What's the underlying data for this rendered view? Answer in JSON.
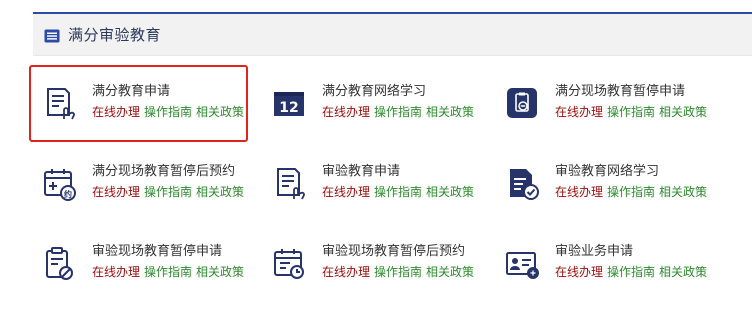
{
  "panel": {
    "title": "满分审验教育",
    "header_icon": "list-card-icon"
  },
  "links": {
    "online": "在线办理",
    "guide": "操作指南",
    "policy": "相关政策"
  },
  "colors": {
    "accent": "#2c4aa7",
    "icon_dark": "#27346a",
    "online": "#9b0d0d",
    "green": "#2e8b2e",
    "highlight": "#e0241b"
  },
  "items": [
    {
      "name": "满分教育申请",
      "icon": "form-hand-icon",
      "selected": true
    },
    {
      "name": "满分教育网络学习",
      "icon": "calendar-12-icon"
    },
    {
      "name": "满分现场教育暂停申请",
      "icon": "clipboard-minus-icon"
    },
    {
      "name": "满分现场教育暂停后预约",
      "icon": "calendar-appointment-icon"
    },
    {
      "name": "审验教育申请",
      "icon": "form-hand-icon"
    },
    {
      "name": "审验教育网络学习",
      "icon": "document-check-icon"
    },
    {
      "name": "审验现场教育暂停申请",
      "icon": "clipboard-ban-icon"
    },
    {
      "name": "审验现场教育暂停后预约",
      "icon": "calendar-clock-icon"
    },
    {
      "name": "审验业务申请",
      "icon": "id-card-icon"
    }
  ]
}
